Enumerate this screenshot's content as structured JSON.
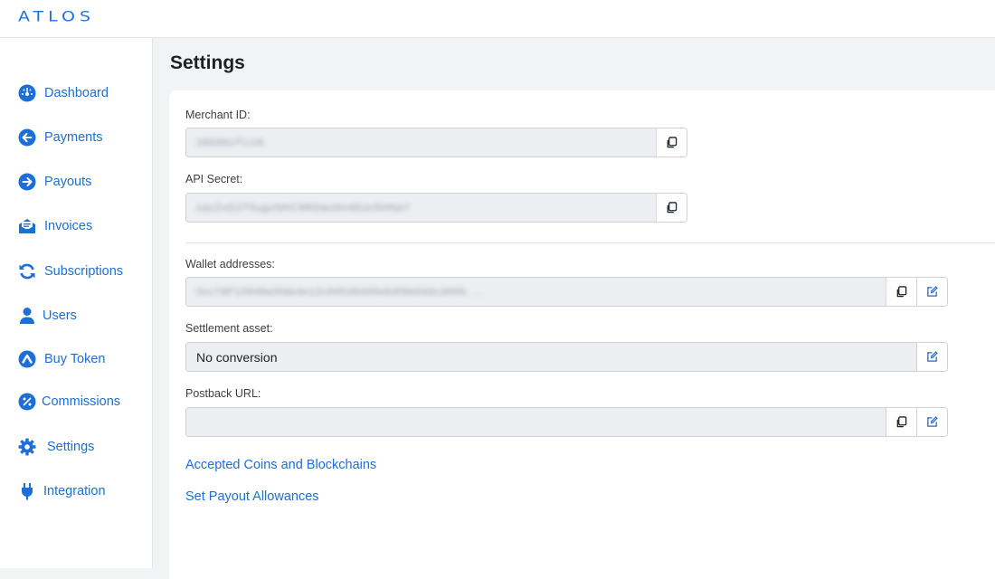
{
  "app": {
    "logo": "ATLOS",
    "brand_color": "#1b73e0"
  },
  "sidebar": {
    "items": [
      {
        "label": "Dashboard",
        "icon": "dashboard-icon"
      },
      {
        "label": "Payments",
        "icon": "arrow-left-circle-icon"
      },
      {
        "label": "Payouts",
        "icon": "arrow-right-circle-icon"
      },
      {
        "label": "Invoices",
        "icon": "invoice-envelope-icon"
      },
      {
        "label": "Subscriptions",
        "icon": "refresh-icon"
      },
      {
        "label": "Users",
        "icon": "user-icon"
      },
      {
        "label": "Buy Token",
        "icon": "atlos-token-icon"
      },
      {
        "label": "Commissions",
        "icon": "percent-icon"
      },
      {
        "label": "Settings",
        "icon": "gear-icon"
      },
      {
        "label": "Integration",
        "icon": "plug-icon"
      }
    ]
  },
  "main": {
    "title": "Settings",
    "merchant_id": {
      "label": "Merchant ID:",
      "value": "28696UTLU6"
    },
    "api_secret": {
      "label": "API Secret:",
      "value": "oacZvD2T9ugvNHC9RDws9n4Eon5HNe7"
    },
    "wallet_addresses": {
      "label": "Wallet addresses:",
      "value": "0xc79F10948e0fde4e12c945384d9eb4f9b93dc3999, ..."
    },
    "settlement_asset": {
      "label": "Settlement asset:",
      "value": "No conversion"
    },
    "postback_url": {
      "label": "Postback URL:",
      "value": ""
    },
    "links": {
      "accepted_coins": "Accepted Coins and Blockchains",
      "payout_allowances": "Set Payout Allowances"
    }
  }
}
